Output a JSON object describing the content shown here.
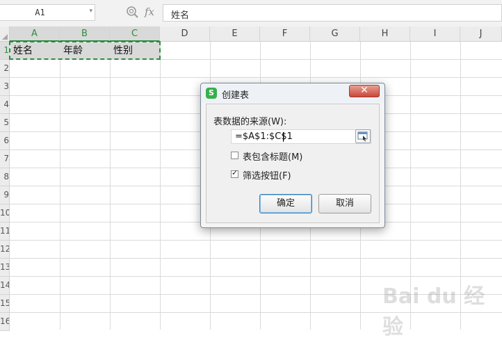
{
  "formula_bar": {
    "name_box_value": "A1",
    "fx_label": "fx",
    "formula_value": "姓名"
  },
  "columns": [
    "A",
    "B",
    "C",
    "D",
    "E",
    "F",
    "G",
    "H",
    "I",
    "J"
  ],
  "selected_columns": [
    "A",
    "B",
    "C"
  ],
  "rows": [
    "1",
    "2",
    "3",
    "4",
    "5",
    "6",
    "7",
    "8",
    "9",
    "10",
    "11",
    "12",
    "13",
    "14",
    "15",
    "16"
  ],
  "cells": {
    "a1": "姓名",
    "b1": "年龄",
    "c1": "性别"
  },
  "dialog": {
    "title": "创建表",
    "app_icon_letter": "S",
    "source_label": "表数据的来源(W):",
    "range_value": "=$A$1:$C$1",
    "header_checkbox_label": "表包含标题(M)",
    "header_checkbox_checked": false,
    "filter_checkbox_label": "筛选按钮(F)",
    "filter_checkbox_checked": true,
    "ok_label": "确定",
    "cancel_label": "取消"
  },
  "watermark": {
    "text": "Bai du 经验"
  },
  "colors": {
    "selection_green": "#2a8d3f",
    "app_icon_green": "#36b04a",
    "close_red": "#c9473a"
  }
}
